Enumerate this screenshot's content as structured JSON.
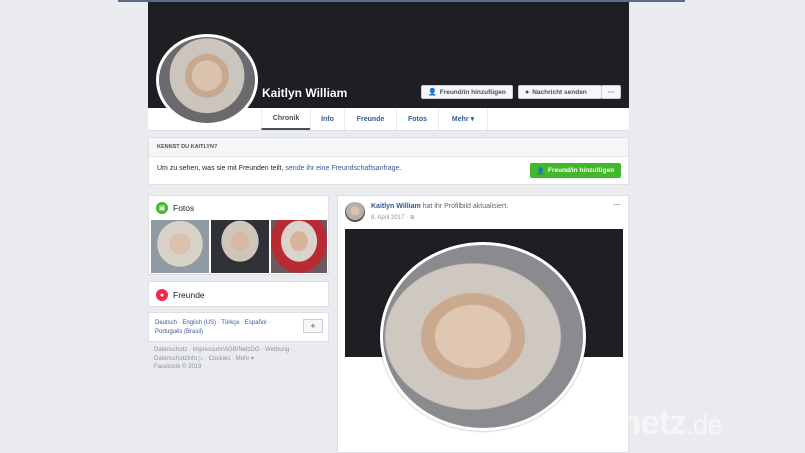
{
  "profile": {
    "name": "Kaitlyn William"
  },
  "cover_buttons": {
    "add_friend": "Freund/in hinzufügen",
    "message": "Nachricht senden",
    "more": "···"
  },
  "tabs": [
    "Chronik",
    "Info",
    "Freunde",
    "Fotos",
    "Mehr ▾"
  ],
  "know": {
    "heading": "KENNST DU KAITLYN?",
    "text": "Um zu sehen, was sie mit Freunden teilt,",
    "link": "sende ihr eine Freundschaftsanfrage.",
    "button": "Freund/in hinzufügen"
  },
  "fotos": {
    "title": "Fotos"
  },
  "freunde": {
    "title": "Freunde"
  },
  "languages": {
    "line1": "Deutsch · English (US) · Türkçe · Español ·",
    "line2": "Português (Brasil)",
    "plus": "+"
  },
  "footer": {
    "line1": "Datenschutz · Impressum/AGB/NetzDG · Werbung ·",
    "line2": "Datenschutzinfo ▷ · Cookies · Mehr ▾",
    "line3": "Facebook © 2019"
  },
  "post": {
    "author": "Kaitlyn William",
    "action": "hat ihr Profilbild aktualisiert.",
    "date": "8. April 2017 · ⊕",
    "menu": "···"
  },
  "watermark": {
    "main": "netz",
    "suffix": ".de"
  },
  "colors": {
    "cover": "#1d1f23",
    "link": "#365899",
    "green": "#42b72a",
    "background": "#e9ebee"
  }
}
